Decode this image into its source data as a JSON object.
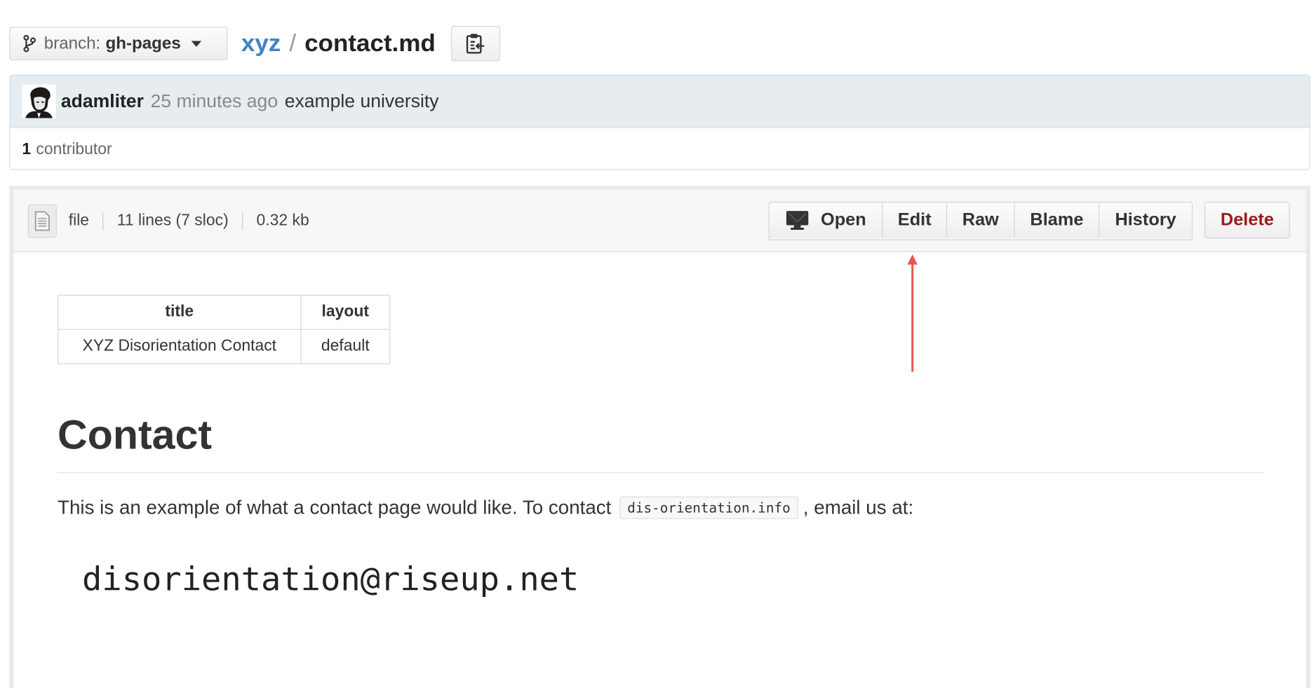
{
  "branch": {
    "prefix": "branch:",
    "name": "gh-pages"
  },
  "breadcrumb": {
    "repo": "xyz",
    "separator": "/",
    "file": "contact.md"
  },
  "commit": {
    "author": "adamliter",
    "time": "25 minutes ago",
    "message": "example university",
    "contributor_count": "1",
    "contributor_label": "contributor"
  },
  "file_meta": {
    "type": "file",
    "lines": "11 lines (7 sloc)",
    "size": "0.32 kb"
  },
  "toolbar": {
    "open": "Open",
    "edit": "Edit",
    "raw": "Raw",
    "blame": "Blame",
    "history": "History",
    "delete": "Delete"
  },
  "front_matter": {
    "headers": [
      "title",
      "layout"
    ],
    "row": [
      "XYZ Disorientation Contact",
      "default"
    ]
  },
  "content": {
    "heading": "Contact",
    "paragraph_before": "This is an example of what a contact page would like. To contact",
    "paragraph_code": "dis-orientation.info",
    "paragraph_after": ", email us at:",
    "email": "disorientation@riseup.net"
  },
  "colors": {
    "link": "#4183c4",
    "delete": "#9a1b1b",
    "annotation": "#e8574d"
  },
  "icons": {
    "branch": "branch-icon",
    "clipboard": "clipboard-icon",
    "file": "file-icon",
    "desktop": "desktop-icon",
    "caret": "caret-down-icon",
    "arrow": "annotation-arrow"
  }
}
